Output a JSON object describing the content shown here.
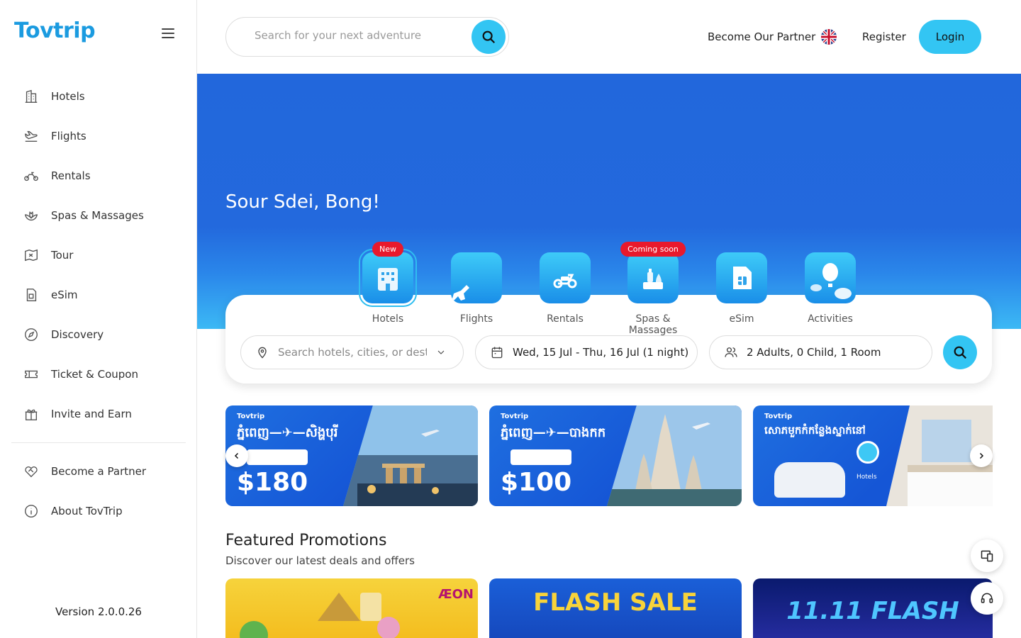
{
  "brand": {
    "name": "Tovtrip"
  },
  "sidebar": {
    "items": [
      {
        "label": "Hotels",
        "icon": "building-icon"
      },
      {
        "label": "Flights",
        "icon": "plane-icon"
      },
      {
        "label": "Rentals",
        "icon": "motorbike-icon"
      },
      {
        "label": "Spas & Massages",
        "icon": "lotus-icon"
      },
      {
        "label": "Tour",
        "icon": "map-icon"
      },
      {
        "label": "eSim",
        "icon": "sim-icon"
      },
      {
        "label": "Discovery",
        "icon": "compass-icon"
      },
      {
        "label": "Ticket & Coupon",
        "icon": "ticket-icon"
      },
      {
        "label": "Invite and Earn",
        "icon": "gift-icon"
      }
    ],
    "secondary": [
      {
        "label": "Become a Partner",
        "icon": "handshake-heart-icon"
      },
      {
        "label": "About TovTrip",
        "icon": "info-icon"
      }
    ],
    "version": "Version 2.0.0.26"
  },
  "header": {
    "search_placeholder": "Search for your next adventure",
    "partner_label": "Become Our Partner",
    "register_label": "Register",
    "login_label": "Login"
  },
  "hero": {
    "greeting": "Sour Sdei, Bong!"
  },
  "categories": [
    {
      "label": "Hotels",
      "badge": "New"
    },
    {
      "label": "Flights"
    },
    {
      "label": "Rentals"
    },
    {
      "label": "Spas & Massages",
      "badge": "Coming soon"
    },
    {
      "label": "eSim"
    },
    {
      "label": "Activities"
    }
  ],
  "search_form": {
    "destination_placeholder": "Search hotels, cities, or destir",
    "dates": "Wed, 15 Jul - Thu, 16 Jul (1 night)",
    "guests": "2 Adults, 0 Child, 1 Room"
  },
  "banners": [
    {
      "brand": "Tovtrip",
      "route": "ភ្នំពេញ—✈—សិង្ហបុរី",
      "price": "$180"
    },
    {
      "brand": "Tovtrip",
      "route": "ភ្នំពេញ—✈—បាងកក",
      "price": "$100"
    },
    {
      "brand": "Tovtrip",
      "route": "សោភមួកកំកន្លែងស្នាក់នៅ",
      "tag": "Hotels"
    }
  ],
  "promotions": {
    "title": "Featured Promotions",
    "subtitle": "Discover our latest deals and offers",
    "items": [
      {
        "text": "ÆON"
      },
      {
        "text": "FLASH SALE"
      },
      {
        "text": "11.11 FLASH"
      }
    ]
  },
  "colors": {
    "accent": "#33c5f3",
    "hero_blue": "#2267dc",
    "badge_red": "#e8192c",
    "logo_blue": "#1b9be0"
  }
}
